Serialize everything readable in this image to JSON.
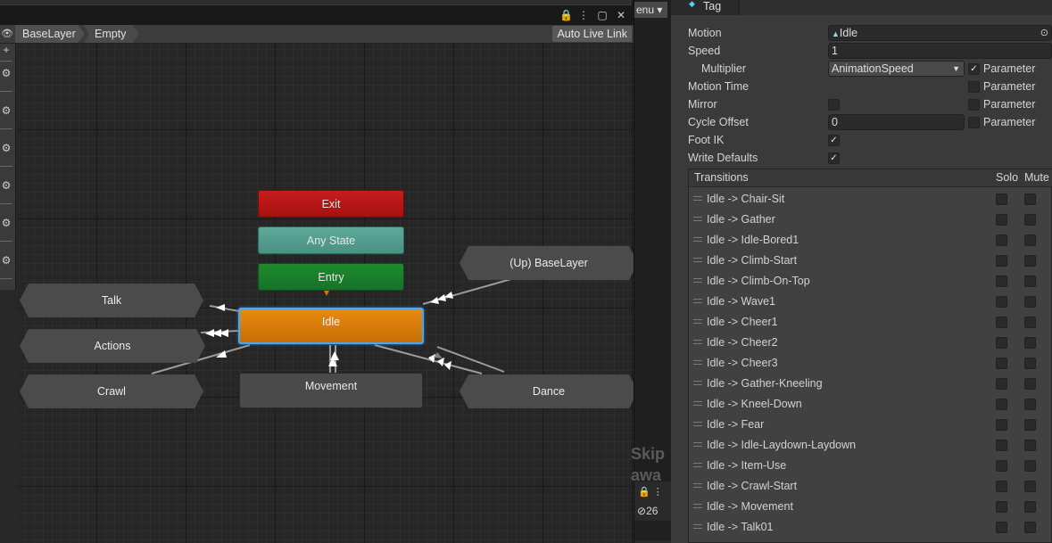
{
  "animator": {
    "breadcrumb": [
      "BaseLayer",
      "Empty"
    ],
    "auto_live_link": "Auto Live Link",
    "nodes": {
      "exit": "Exit",
      "any_state": "Any State",
      "entry": "Entry",
      "idle": "Idle",
      "movement": "Movement",
      "talk": "Talk",
      "actions": "Actions",
      "crawl": "Crawl",
      "up_baselayer": "(Up) BaseLayer",
      "dance": "Dance"
    }
  },
  "mid": {
    "menu_label": "enu",
    "skip_text": "Skip\nawa",
    "count": "26"
  },
  "inspector": {
    "tag_label": "Tag",
    "motion": {
      "label": "Motion",
      "value": "Idle"
    },
    "speed": {
      "label": "Speed",
      "value": "1"
    },
    "multiplier": {
      "label": "Multiplier",
      "value": "AnimationSpeed",
      "parameter": "Parameter",
      "checked": true
    },
    "motion_time": {
      "label": "Motion Time",
      "parameter": "Parameter"
    },
    "mirror": {
      "label": "Mirror",
      "parameter": "Parameter"
    },
    "cycle_offset": {
      "label": "Cycle Offset",
      "value": "0",
      "parameter": "Parameter"
    },
    "foot_ik": {
      "label": "Foot IK",
      "checked": true
    },
    "write_defaults": {
      "label": "Write Defaults",
      "checked": true
    },
    "transitions": {
      "header": "Transitions",
      "solo": "Solo",
      "mute": "Mute",
      "rows": [
        "Idle -> Chair-Sit",
        "Idle -> Gather",
        "Idle -> Idle-Bored1",
        "Idle -> Climb-Start",
        "Idle -> Climb-On-Top",
        "Idle -> Wave1",
        "Idle -> Cheer1",
        "Idle -> Cheer2",
        "Idle -> Cheer3",
        "Idle -> Gather-Kneeling",
        "Idle -> Kneel-Down",
        "Idle -> Fear",
        "Idle -> Idle-Laydown-Laydown",
        "Idle -> Item-Use",
        "Idle -> Crawl-Start",
        "Idle -> Movement",
        "Idle -> Talk01"
      ]
    }
  }
}
